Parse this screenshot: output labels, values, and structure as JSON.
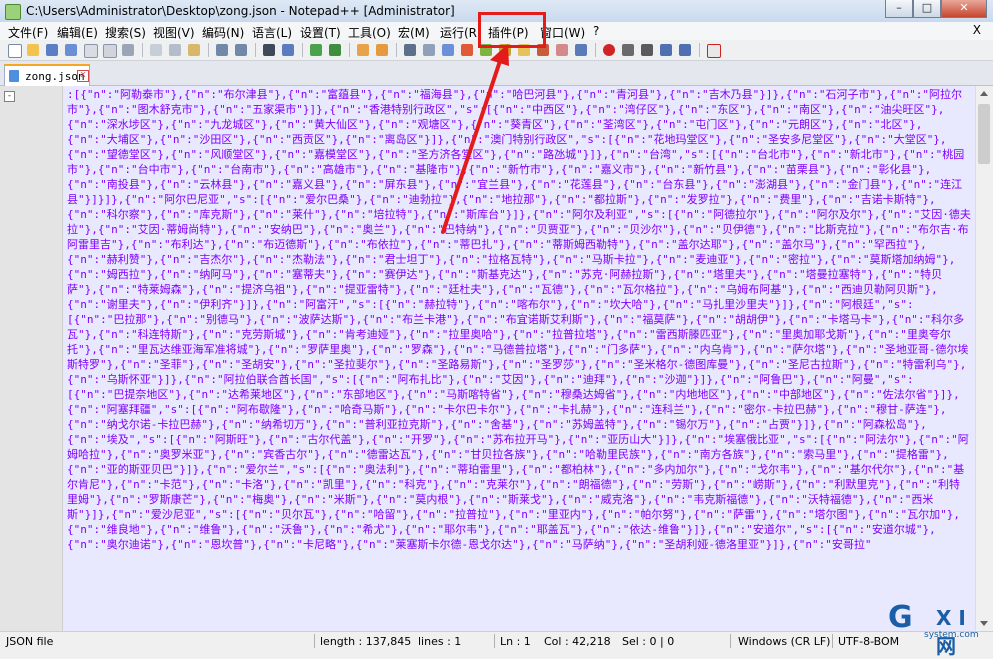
{
  "window": {
    "title": "C:\\Users\\Administrator\\Desktop\\zong.json - Notepad++ [Administrator]",
    "minimize": "–",
    "maximize": "□",
    "close": "✕"
  },
  "menu": {
    "items": [
      {
        "label": "文件(F)"
      },
      {
        "label": "编辑(E)"
      },
      {
        "label": "搜索(S)"
      },
      {
        "label": "视图(V)"
      },
      {
        "label": "编码(N)"
      },
      {
        "label": "语言(L)"
      },
      {
        "label": "设置(T)"
      },
      {
        "label": "工具(O)"
      },
      {
        "label": "宏(M)"
      },
      {
        "label": "运行(R)"
      },
      {
        "label": "插件(P)"
      },
      {
        "label": "窗口(W)"
      },
      {
        "label": "?"
      }
    ],
    "close_label": "X"
  },
  "tab": {
    "label": "zong.json",
    "close": "x"
  },
  "editor": {
    "fold_marker": "-",
    "content": ":[{\"n\":\"阿勒泰市\"},{\"n\":\"布尔津县\"},{\"n\":\"富蕴县\"},{\"n\":\"福海县\"},{\"n\":\"哈巴河县\"},{\"n\":\"青河县\"},{\"n\":\"吉木乃县\"}]},{\"n\":\"石河子市\"},{\"n\":\"阿拉尔市\"},{\"n\":\"图木舒克市\"},{\"n\":\"五家渠市\"}]},{\"n\":\"香港特别行政区\",\"s\":[{\"n\":\"中西区\"},{\"n\":\"湾仔区\"},{\"n\":\"东区\"},{\"n\":\"南区\"},{\"n\":\"油尖旺区\"},{\"n\":\"深水埗区\"},{\"n\":\"九龙城区\"},{\"n\":\"黄大仙区\"},{\"n\":\"观塘区\"},{\"n\":\"葵青区\"},{\"n\":\"荃湾区\"},{\"n\":\"屯门区\"},{\"n\":\"元朗区\"},{\"n\":\"北区\"},{\"n\":\"大埔区\"},{\"n\":\"沙田区\"},{\"n\":\"西贡区\"},{\"n\":\"离岛区\"}]},{\"n\":\"澳门特别行政区\",\"s\":[{\"n\":\"花地玛堂区\"},{\"n\":\"圣安多尼堂区\"},{\"n\":\"大堂区\"},{\"n\":\"望德堂区\"},{\"n\":\"风顺堂区\"},{\"n\":\"嘉模堂区\"},{\"n\":\"圣方济各堂区\"},{\"n\":\"路氹城\"}]},{\"n\":\"台湾\",\"s\":[{\"n\":\"台北市\"},{\"n\":\"新北市\"},{\"n\":\"桃园市\"},{\"n\":\"台中市\"},{\"n\":\"台南市\"},{\"n\":\"高雄市\"},{\"n\":\"基隆市\"},{\"n\":\"新竹市\"},{\"n\":\"嘉义市\"},{\"n\":\"新竹县\"},{\"n\":\"苗栗县\"},{\"n\":\"彰化县\"},{\"n\":\"南投县\"},{\"n\":\"云林县\"},{\"n\":\"嘉义县\"},{\"n\":\"屏东县\"},{\"n\":\"宜兰县\"},{\"n\":\"花莲县\"},{\"n\":\"台东县\"},{\"n\":\"澎湖县\"},{\"n\":\"金门县\"},{\"n\":\"连江县\"}]}]},{\"n\":\"阿尔巴尼亚\",\"s\":[{\"n\":\"爱尔巴桑\"},{\"n\":\"迪勃拉\"},{\"n\":\"地拉那\"},{\"n\":\"都拉斯\"},{\"n\":\"发罗拉\"},{\"n\":\"费里\"},{\"n\":\"吉诺卡斯特\"},{\"n\":\"科尔察\"},{\"n\":\"库克斯\"},{\"n\":\"莱什\"},{\"n\":\"培拉特\"},{\"n\":\"斯库台\"}]},{\"n\":\"阿尔及利亚\",\"s\":[{\"n\":\"阿德拉尔\"},{\"n\":\"阿尔及尔\"},{\"n\":\"艾因·德夫拉\"},{\"n\":\"艾因·蒂姆尚特\"},{\"n\":\"安纳巴\"},{\"n\":\"奥兰\"},{\"n\":\"巴特纳\"},{\"n\":\"贝贾亚\"},{\"n\":\"贝沙尔\"},{\"n\":\"贝伊德\"},{\"n\":\"比斯克拉\"},{\"n\":\"布尔吉·布阿雷里吉\"},{\"n\":\"布利达\"},{\"n\":\"布迈德斯\"},{\"n\":\"布依拉\"},{\"n\":\"蒂巴扎\"},{\"n\":\"蒂斯姆西勒特\"},{\"n\":\"盖尔达耶\"},{\"n\":\"盖尔马\"},{\"n\":\"罕西拉\"},{\"n\":\"赫利赞\"},{\"n\":\"吉杰尔\"},{\"n\":\"杰勒法\"},{\"n\":\"君士坦丁\"},{\"n\":\"拉格瓦特\"},{\"n\":\"马斯卡拉\"},{\"n\":\"麦迪亚\"},{\"n\":\"密拉\"},{\"n\":\"莫斯塔加纳姆\"},{\"n\":\"姆西拉\"},{\"n\":\"纳阿马\"},{\"n\":\"塞蒂夫\"},{\"n\":\"赛伊达\"},{\"n\":\"斯基克达\"},{\"n\":\"苏克·阿赫拉斯\"},{\"n\":\"塔里夫\"},{\"n\":\"塔曼拉塞特\"},{\"n\":\"特贝萨\"},{\"n\":\"特莱姆森\"},{\"n\":\"提济乌祖\"},{\"n\":\"提亚雷特\"},{\"n\":\"廷杜夫\"},{\"n\":\"瓦德\"},{\"n\":\"瓦尔格拉\"},{\"n\":\"乌姆布阿基\"},{\"n\":\"西迪贝勒阿贝斯\"},{\"n\":\"谢里夫\"},{\"n\":\"伊利齐\"}]},{\"n\":\"阿富汗\",\"s\":[{\"n\":\"赫拉特\"},{\"n\":\"喀布尔\"},{\"n\":\"坎大哈\"},{\"n\":\"马扎里沙里夫\"}]},{\"n\":\"阿根廷\",\"s\":[{\"n\":\"巴拉那\"},{\"n\":\"别德马\"},{\"n\":\"波萨达斯\"},{\"n\":\"布兰卡港\"},{\"n\":\"布宜诺斯艾利斯\"},{\"n\":\"福莫萨\"},{\"n\":\"胡胡伊\"},{\"n\":\"卡塔马卡\"},{\"n\":\"科尔多瓦\"},{\"n\":\"科连特斯\"},{\"n\":\"克劳斯城\"},{\"n\":\"肯考迪娅\"},{\"n\":\"拉里奥哈\"},{\"n\":\"拉普拉塔\"},{\"n\":\"雷西斯滕匹亚\"},{\"n\":\"里奥加耶戈斯\"},{\"n\":\"里奥夸尔托\"},{\"n\":\"里瓦达维亚海军准将城\"},{\"n\":\"罗萨里奥\"},{\"n\":\"罗森\"},{\"n\":\"马德普拉塔\"},{\"n\":\"门多萨\"},{\"n\":\"内乌肯\"},{\"n\":\"萨尔塔\"},{\"n\":\"圣地亚哥-德尔埃斯特罗\"},{\"n\":\"圣菲\"},{\"n\":\"圣胡安\"},{\"n\":\"圣拉斐尔\"},{\"n\":\"圣路易斯\"},{\"n\":\"圣罗莎\"},{\"n\":\"圣米格尔-德图库曼\"},{\"n\":\"圣尼古拉斯\"},{\"n\":\"特雷利乌\"},{\"n\":\"乌斯怀亚\"}]},{\"n\":\"阿拉伯联合酋长国\",\"s\":[{\"n\":\"阿布扎比\"},{\"n\":\"艾因\"},{\"n\":\"迪拜\"},{\"n\":\"沙迦\"}]},{\"n\":\"阿鲁巴\"},{\"n\":\"阿曼\",\"s\":[{\"n\":\"巴提奈地区\"},{\"n\":\"达希莱地区\"},{\"n\":\"东部地区\"},{\"n\":\"马斯喀特省\"},{\"n\":\"穆桑达姆省\"},{\"n\":\"内地地区\"},{\"n\":\"中部地区\"},{\"n\":\"佐法尔省\"}]},{\"n\":\"阿塞拜疆\",\"s\":[{\"n\":\"阿布歇隆\"},{\"n\":\"哈奇马斯\"},{\"n\":\"卡尔巴卡尔\"},{\"n\":\"卡扎赫\"},{\"n\":\"连科兰\"},{\"n\":\"密尔-卡拉巴赫\"},{\"n\":\"穆甘-萨连\"},{\"n\":\"纳戈尔诺-卡拉巴赫\"},{\"n\":\"纳希切万\"},{\"n\":\"普利亚拉克斯\"},{\"n\":\"舍基\"},{\"n\":\"苏姆盖特\"},{\"n\":\"锡尔万\"},{\"n\":\"占贾\"}]},{\"n\":\"阿森松岛\"},{\"n\":\"埃及\",\"s\":[{\"n\":\"阿斯旺\"},{\"n\":\"古尔代盖\"},{\"n\":\"开罗\"},{\"n\":\"苏布拉开马\"},{\"n\":\"亚历山大\"}]},{\"n\":\"埃塞俄比亚\",\"s\":[{\"n\":\"阿法尔\"},{\"n\":\"阿姆哈拉\"},{\"n\":\"奥罗米亚\"},{\"n\":\"宾香古尔\"},{\"n\":\"德雷达瓦\"},{\"n\":\"甘贝拉各族\"},{\"n\":\"哈勒里民族\"},{\"n\":\"南方各族\"},{\"n\":\"索马里\"},{\"n\":\"提格雷\"},{\"n\":\"亚的斯亚贝巴\"}]},{\"n\":\"爱尔兰\",\"s\":[{\"n\":\"奥法利\"},{\"n\":\"蒂珀雷里\"},{\"n\":\"都柏林\"},{\"n\":\"多内加尔\"},{\"n\":\"戈尔韦\"},{\"n\":\"基尔代尔\"},{\"n\":\"基尔肯尼\"},{\"n\":\"卡范\"},{\"n\":\"卡洛\"},{\"n\":\"凯里\"},{\"n\":\"科克\"},{\"n\":\"克莱尔\"},{\"n\":\"朗福德\"},{\"n\":\"劳斯\"},{\"n\":\"崂斯\"},{\"n\":\"利默里克\"},{\"n\":\"利特里姆\"},{\"n\":\"罗斯康芒\"},{\"n\":\"梅奥\"},{\"n\":\"米斯\"},{\"n\":\"莫内根\"},{\"n\":\"斯莱戈\"},{\"n\":\"威克洛\"},{\"n\":\"韦克斯福德\"},{\"n\":\"沃特福德\"},{\"n\":\"西米斯\"}]},{\"n\":\"爱沙尼亚\",\"s\":[{\"n\":\"贝尔瓦\"},{\"n\":\"哈留\"},{\"n\":\"拉普拉\"},{\"n\":\"里亚内\"},{\"n\":\"帕尔努\"},{\"n\":\"萨雷\"},{\"n\":\"塔尔图\"},{\"n\":\"瓦尔加\"},{\"n\":\"维良地\"},{\"n\":\"维鲁\"},{\"n\":\"沃鲁\"},{\"n\":\"希尤\"},{\"n\":\"耶尔韦\"},{\"n\":\"耶盖瓦\"},{\"n\":\"依达-维鲁\"}]},{\"n\":\"安道尔\",\"s\":[{\"n\":\"安道尔城\"},{\"n\":\"奥尔迪诺\"},{\"n\":\"恩坎普\"},{\"n\":\"卡尼略\"},{\"n\":\"莱塞斯卡尔德-恩戈尔达\"},{\"n\":\"马萨纳\"},{\"n\":\"圣胡利娅-德洛里亚\"}]},{\"n\":\"安哥拉\""
  },
  "status": {
    "file_type": "JSON file",
    "length": "length : 137,845",
    "lines": "lines : 1",
    "ln": "Ln : 1",
    "col": "Col : 42,218",
    "sel": "Sel : 0 | 0",
    "eol": "Windows (CR LF)",
    "encoding": "UTF-8-BOM"
  },
  "watermark": {
    "text_g": "G",
    "text_xi": "X I 网",
    "text_site": "system.com"
  },
  "colors": {
    "highlight": "#e41b1b",
    "json_text": "#8000ff",
    "editor_bg": "#e8e8ff"
  }
}
